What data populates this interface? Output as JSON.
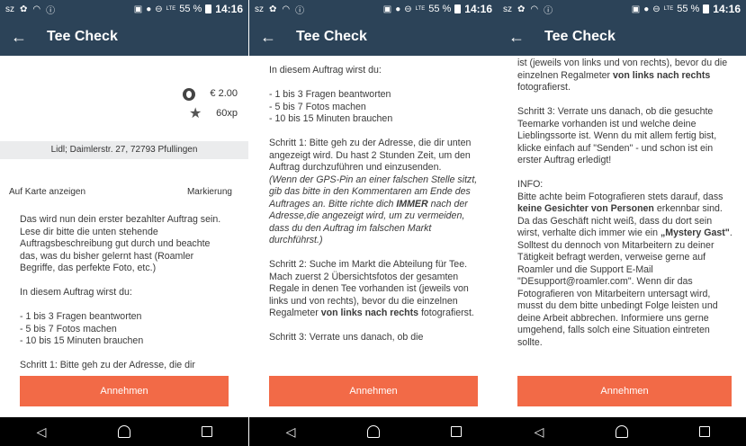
{
  "statusbar": {
    "battery": "55 %",
    "time": "14:16",
    "lte": "LTE"
  },
  "app": {
    "title": "Tee Check"
  },
  "reward": {
    "money": "€ 2.00",
    "xp": "60xp"
  },
  "address": "Lidl; Daimlerstr. 27, 72793 Pfullingen",
  "actions": {
    "map": "Auf Karte anzeigen",
    "mark": "Markierung"
  },
  "button": "Annehmen",
  "text": {
    "intro": "Das wird nun dein erster bezahlter Auftrag sein. Lese dir bitte die unten stehende Auftragsbeschreibung gut durch und beachte das, was du bisher gelernt hast (Roamler Begriffe, das perfekte Foto, etc.)",
    "in_diesem": "In diesem Auftrag wirst du:",
    "list1": "- 1 bis 3 Fragen beantworten",
    "list2": "- 5 bis 7 Fotos machen",
    "list3": "- 10 bis 15 Minuten brauchen",
    "cut1": "Schritt 1: Bitte geh zu der Adresse, die dir",
    "schritt1": "Schritt 1: Bitte geh zu der Adresse, die dir unten angezeigt wird. Du hast 2 Stunden Zeit, um den Auftrag durchzuführen und einzusenden.",
    "gps_a": "(Wenn der GPS-Pin an einer falschen Stelle sitzt, gib das bitte in den Kommentaren am Ende des Auftrages an. Bitte richte dich ",
    "gps_bold": "IMMER",
    "gps_b": " nach der Adresse,die angezeigt wird, um zu vermeiden, dass du den Auftrag im falschen Markt durchführst.)",
    "schritt2_a": "Schritt 2: Suche im Markt die Abteilung für Tee. Mach zuerst 2 Übersichtsfotos der gesamten Regale in denen Tee vorhanden ist (jeweils von links und von rechts), bevor du die einzelnen Regalmeter ",
    "schritt2_bold": "von links nach rechts",
    "schritt2_b": " fotografierst.",
    "schritt3_cut": "Schritt 3: Verrate uns danach, ob die",
    "s3_top_a": "ist (jeweils von links und von rechts), bevor du die einzelnen Regalmeter ",
    "s3_top_bold": "von links nach rechts",
    "s3_top_b": " fotografierst.",
    "schritt3": "Schritt 3: Verrate uns danach, ob die gesuchte Teemarke vorhanden ist und welche deine Lieblingssorte ist. Wenn du mit allem fertig bist, klicke einfach auf \"Senden\" - und schon ist ein erster Auftrag erledigt!",
    "info_title": "INFO:",
    "info_a": "Bitte achte beim Fotografieren stets darauf, dass ",
    "info_bold1": "keine Gesichter von Personen",
    "info_b": " erkennbar sind. Da das Geschäft nicht weiß, dass du dort sein wirst, verhalte dich immer wie ein ",
    "info_bold2": "„Mystery Gast\"",
    "info_c": ". Solltest du dennoch von Mitarbeitern zu deiner Tätigkeit befragt werden, verweise gerne auf Roamler und die Support E-Mail \"DEsupport@roamler.com\". Wenn dir das Fotografieren von Mitarbeitern untersagt wird, musst du dem bitte unbedingt Folge leisten und deine Arbeit abbrechen. Informiere uns gerne umgehend, falls solch eine Situation eintreten sollte."
  }
}
